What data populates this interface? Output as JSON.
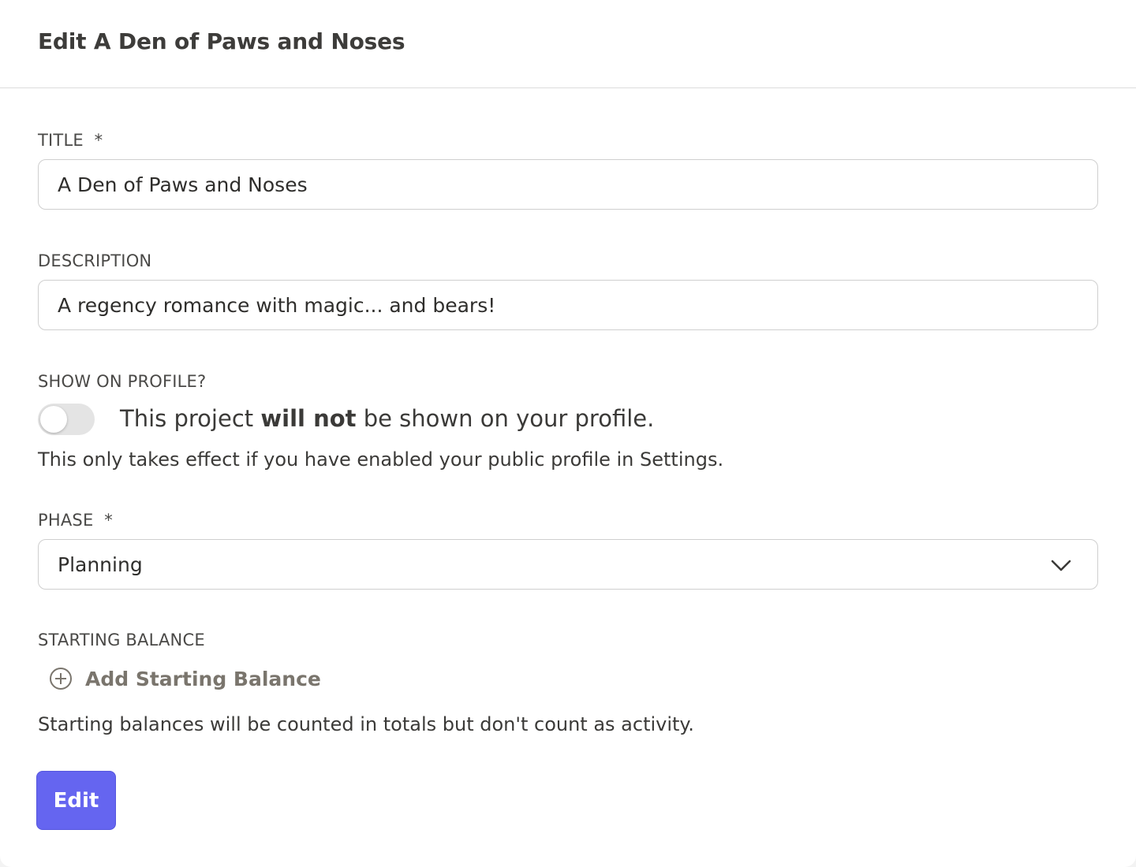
{
  "header": {
    "title": "Edit A Den of Paws and Noses"
  },
  "form": {
    "title_label": "TITLE",
    "title_required": "*",
    "title_value": "A Den of Paws and Noses",
    "description_label": "DESCRIPTION",
    "description_value": "A regency romance with magic... and bears!",
    "show_on_profile_label": "SHOW ON PROFILE?",
    "show_on_profile_enabled": false,
    "toggle_text_before": "This project ",
    "toggle_text_bold": "will not",
    "toggle_text_after": " be shown on your profile.",
    "profile_note": "This only takes effect if you have enabled your public profile in Settings.",
    "phase_label": "PHASE",
    "phase_required": "*",
    "phase_value": "Planning",
    "starting_balance_label": "STARTING BALANCE",
    "add_starting_balance": "Add Starting Balance",
    "starting_balance_note": "Starting balances will be counted in totals but don't count as activity.",
    "submit_label": "Edit"
  },
  "icons": {
    "phase_dropdown": "chevron-down-icon",
    "add_balance": "plus-circle-icon"
  },
  "colors": {
    "primary_button": "#6565f0",
    "add_balance_text": "#7a756d",
    "toggle_off": "#e4e4e4"
  }
}
